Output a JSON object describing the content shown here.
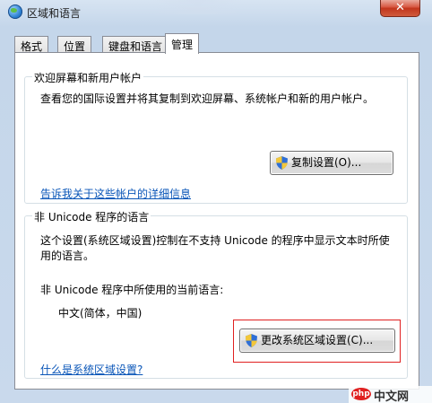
{
  "window": {
    "title": "区域和语言",
    "close_label": "✕"
  },
  "tabs": [
    {
      "label": "格式"
    },
    {
      "label": "位置"
    },
    {
      "label": "键盘和语言"
    },
    {
      "label": "管理",
      "active": true
    }
  ],
  "welcome_group": {
    "title": "欢迎屏幕和新用户帐户",
    "description": "查看您的国际设置并将其复制到欢迎屏幕、系统帐户和新的用户帐户。",
    "copy_button": "复制设置(O)...",
    "link": "告诉我关于这些帐户的详细信息"
  },
  "unicode_group": {
    "title": "非 Unicode 程序的语言",
    "description_line1": "这个设置(系统区域设置)控制在不支持 Unicode 的程序中显示文本时所使",
    "description_line2": "用的语言。",
    "current_label": "非 Unicode 程序中所使用的当前语言:",
    "current_value": "中文(简体，中国)",
    "change_button": "更改系统区域设置(C)...",
    "link": "什么是系统区域设置?"
  },
  "watermark": {
    "logo": "php",
    "text": "中文网"
  },
  "colors": {
    "link": "#0a56b8",
    "highlight_border": "#e02020",
    "window_chrome": "#c9d9ec"
  }
}
